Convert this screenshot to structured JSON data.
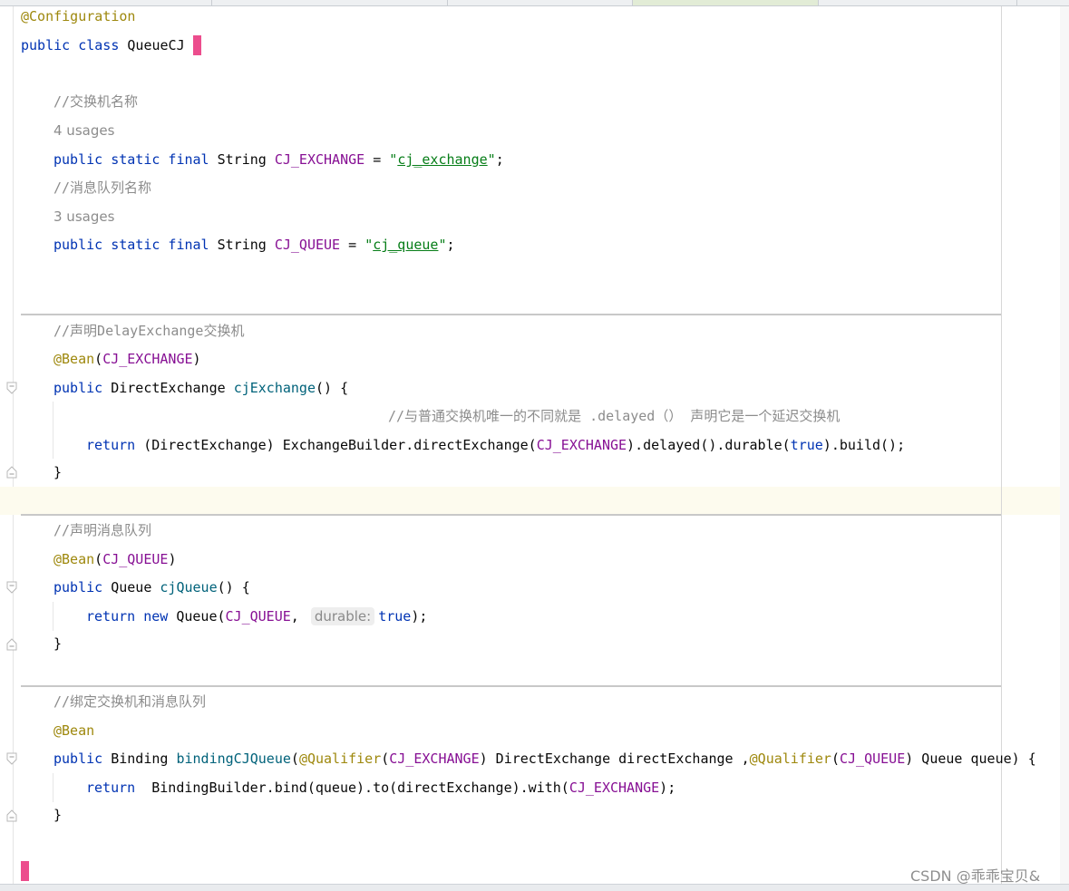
{
  "editor": {
    "class_annotation": "@Configuration",
    "class_decl": {
      "kw": "public class",
      "name": "QueueCJ",
      "brace": "{"
    },
    "fields": [
      {
        "comment": "//交换机名称",
        "usages": "4 usages",
        "modifiers": "public static final",
        "type": "String",
        "name": "CJ_EXCHANGE",
        "eq": " = ",
        "string_quote_open": "\"",
        "string_value": "cj_exchange",
        "string_quote_close": "\"",
        "end": ";"
      },
      {
        "comment": "//消息队列名称",
        "usages": "3 usages",
        "modifiers": "public static final",
        "type": "String",
        "name": "CJ_QUEUE",
        "eq": " = ",
        "string_quote_open": "\"",
        "string_value": "cj_queue",
        "string_quote_close": "\"",
        "end": ";"
      }
    ],
    "method_exchange": {
      "comment": "//声明DelayExchange交换机",
      "annotation": "@Bean",
      "annotation_arg": "CJ_EXCHANGE",
      "kw": "public",
      "return_type": "DirectExchange",
      "name": "cjExchange",
      "params": "() {",
      "inner_comment": "//与普通交换机唯一的不同就是 .delayed（） 声明它是一个延迟交换机",
      "return_kw": "return",
      "body_a": " (DirectExchange) ExchangeBuilder.directExchange(",
      "body_const": "CJ_EXCHANGE",
      "body_b": ").delayed().durable(",
      "body_true": "true",
      "body_c": ").build();",
      "close": "}"
    },
    "method_queue": {
      "comment": "//声明消息队列",
      "annotation": "@Bean",
      "annotation_arg": "CJ_QUEUE",
      "kw": "public",
      "return_type": "Queue",
      "name": "cjQueue",
      "params": "() {",
      "return_kw": "return",
      "new_kw": "new",
      "body_a": " Queue(",
      "body_const": "CJ_QUEUE",
      "body_b": ",",
      "param_hint": "durable:",
      "body_true": "true",
      "body_c": ");",
      "close": "}"
    },
    "method_binding": {
      "comment": "//绑定交换机和消息队列",
      "annotation": "@Bean",
      "kw": "public",
      "return_type": "Binding",
      "name": "bindingCJQueue",
      "p1_ann": "@Qualifier",
      "p1_const": "CJ_EXCHANGE",
      "p1_rest": " DirectExchange directExchange ,",
      "p2_ann": "@Qualifier",
      "p2_const": "CJ_QUEUE",
      "p2_rest": " Queue queue) {",
      "return_kw": "return",
      "body_a": "  BindingBuilder.bind(queue).to(directExchange).with(",
      "body_const": "CJ_EXCHANGE",
      "body_b": ");",
      "close": "}"
    },
    "class_close": "}"
  },
  "watermark": "CSDN @乖乖宝贝&",
  "colors": {
    "keyword": "#0033b3",
    "annotation": "#9e880d",
    "constant": "#871094",
    "method": "#00627a",
    "comment": "#8c8c8c",
    "string": "#067d17",
    "brace_highlight": "#ec4d8d",
    "caret_row": "#fdfbee"
  }
}
